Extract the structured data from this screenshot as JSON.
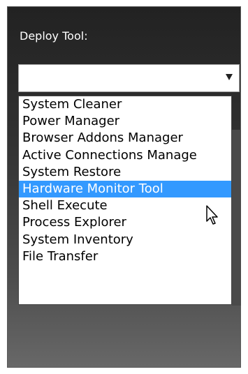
{
  "deploy": {
    "label": "Deploy Tool:",
    "selected_value": "",
    "dropdown_icon": "chevron-down-icon"
  },
  "options": [
    {
      "label": "System Cleaner",
      "selected": false
    },
    {
      "label": "Power Manager",
      "selected": false
    },
    {
      "label": "Browser Addons Manager",
      "selected": false
    },
    {
      "label": "Active Connections Manage",
      "selected": false
    },
    {
      "label": "System Restore",
      "selected": false
    },
    {
      "label": "Hardware Monitor Tool",
      "selected": true
    },
    {
      "label": "Shell Execute",
      "selected": false
    },
    {
      "label": "Process Explorer",
      "selected": false
    },
    {
      "label": "System Inventory",
      "selected": false
    },
    {
      "label": "File Transfer",
      "selected": false
    }
  ],
  "colors": {
    "highlight": "#3399ff",
    "panel_dark": "#222222",
    "label_text": "#ffffff"
  }
}
